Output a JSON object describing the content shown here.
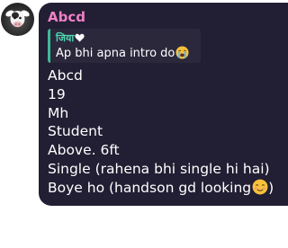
{
  "message": {
    "sender": "Abcd",
    "reply": {
      "name": "जिया",
      "heart_icon": "white-heart-icon",
      "text": "Ap bhi apna intro do",
      "emoji_icon": "loudly-crying-face-emoji"
    },
    "lines": [
      "Abcd",
      "19",
      "Mh",
      "Student",
      "Above. 6ft",
      "Single (rahena bhi single hi hai)",
      "Boye ho (handson gd looking"
    ],
    "last_line_emoji_icon": "smiling-face-emoji",
    "last_line_suffix": ")"
  },
  "colors": {
    "bubble": "#221e33",
    "sender": "#f080c8",
    "reply_bg": "#2b283c",
    "reply_accent": "#3fb89a",
    "reply_name": "#4fd6b0",
    "text": "#ffffff"
  }
}
